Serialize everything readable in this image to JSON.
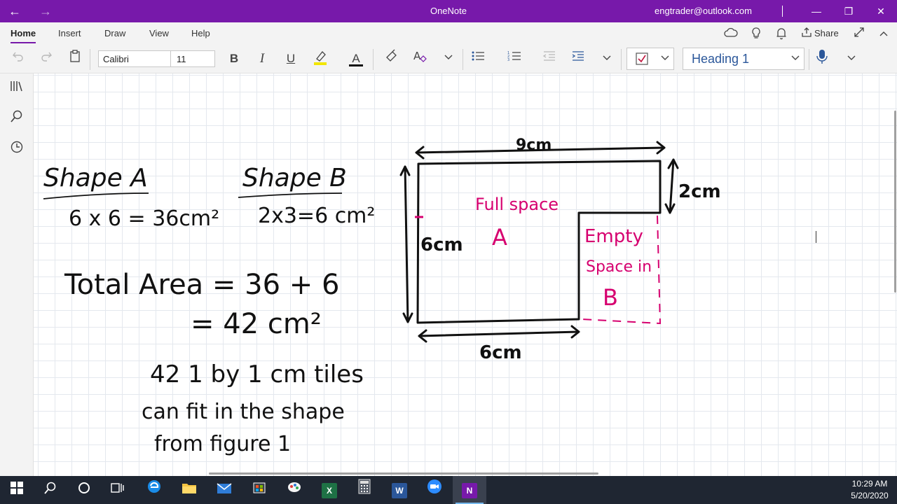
{
  "titlebar": {
    "back": "←",
    "forward": "→",
    "title": "OneNote",
    "account": "engtrader@outlook.com",
    "minimize": "—",
    "restore": "❐",
    "close": "✕"
  },
  "ribbon": {
    "tabs": [
      "Home",
      "Insert",
      "Draw",
      "View",
      "Help"
    ],
    "share_label": "Share"
  },
  "toolbar": {
    "font_name": "Calibri",
    "font_size": "11",
    "bold": "B",
    "italic": "I",
    "underline": "U",
    "font_color_letter": "A",
    "highlight_color": "#f2e600",
    "font_color": "#c00000",
    "style": "Heading 1"
  },
  "notes": {
    "shape_a": {
      "title": "Shape A",
      "calc": "6 x 6 = 36cm²"
    },
    "shape_b": {
      "title": "Shape B",
      "calc": "2x3=6 cm²"
    },
    "total_line1": "Total Area = 36 + 6",
    "total_line2": "= 42 cm²",
    "tiles_line1": "42 1 by 1 cm tiles",
    "tiles_line2": "can fit in the shape",
    "tiles_line3": "from figure 1"
  },
  "figure": {
    "top_width": "9cm",
    "right_height": "2cm",
    "left_height": "6cm",
    "bottom_width": "6cm",
    "region_a_line1": "Full space",
    "region_a_line2": "A",
    "region_b_line1": "Empty",
    "region_b_line2": "Space in",
    "region_b_line3": "B",
    "ink_color": "#111111",
    "accent_color": "#d6006f"
  },
  "taskbar": {
    "time": "10:29 AM",
    "date": "5/20/2020"
  },
  "colors": {
    "onenote_purple": "#7719aa",
    "taskbar": "#1f2632"
  }
}
